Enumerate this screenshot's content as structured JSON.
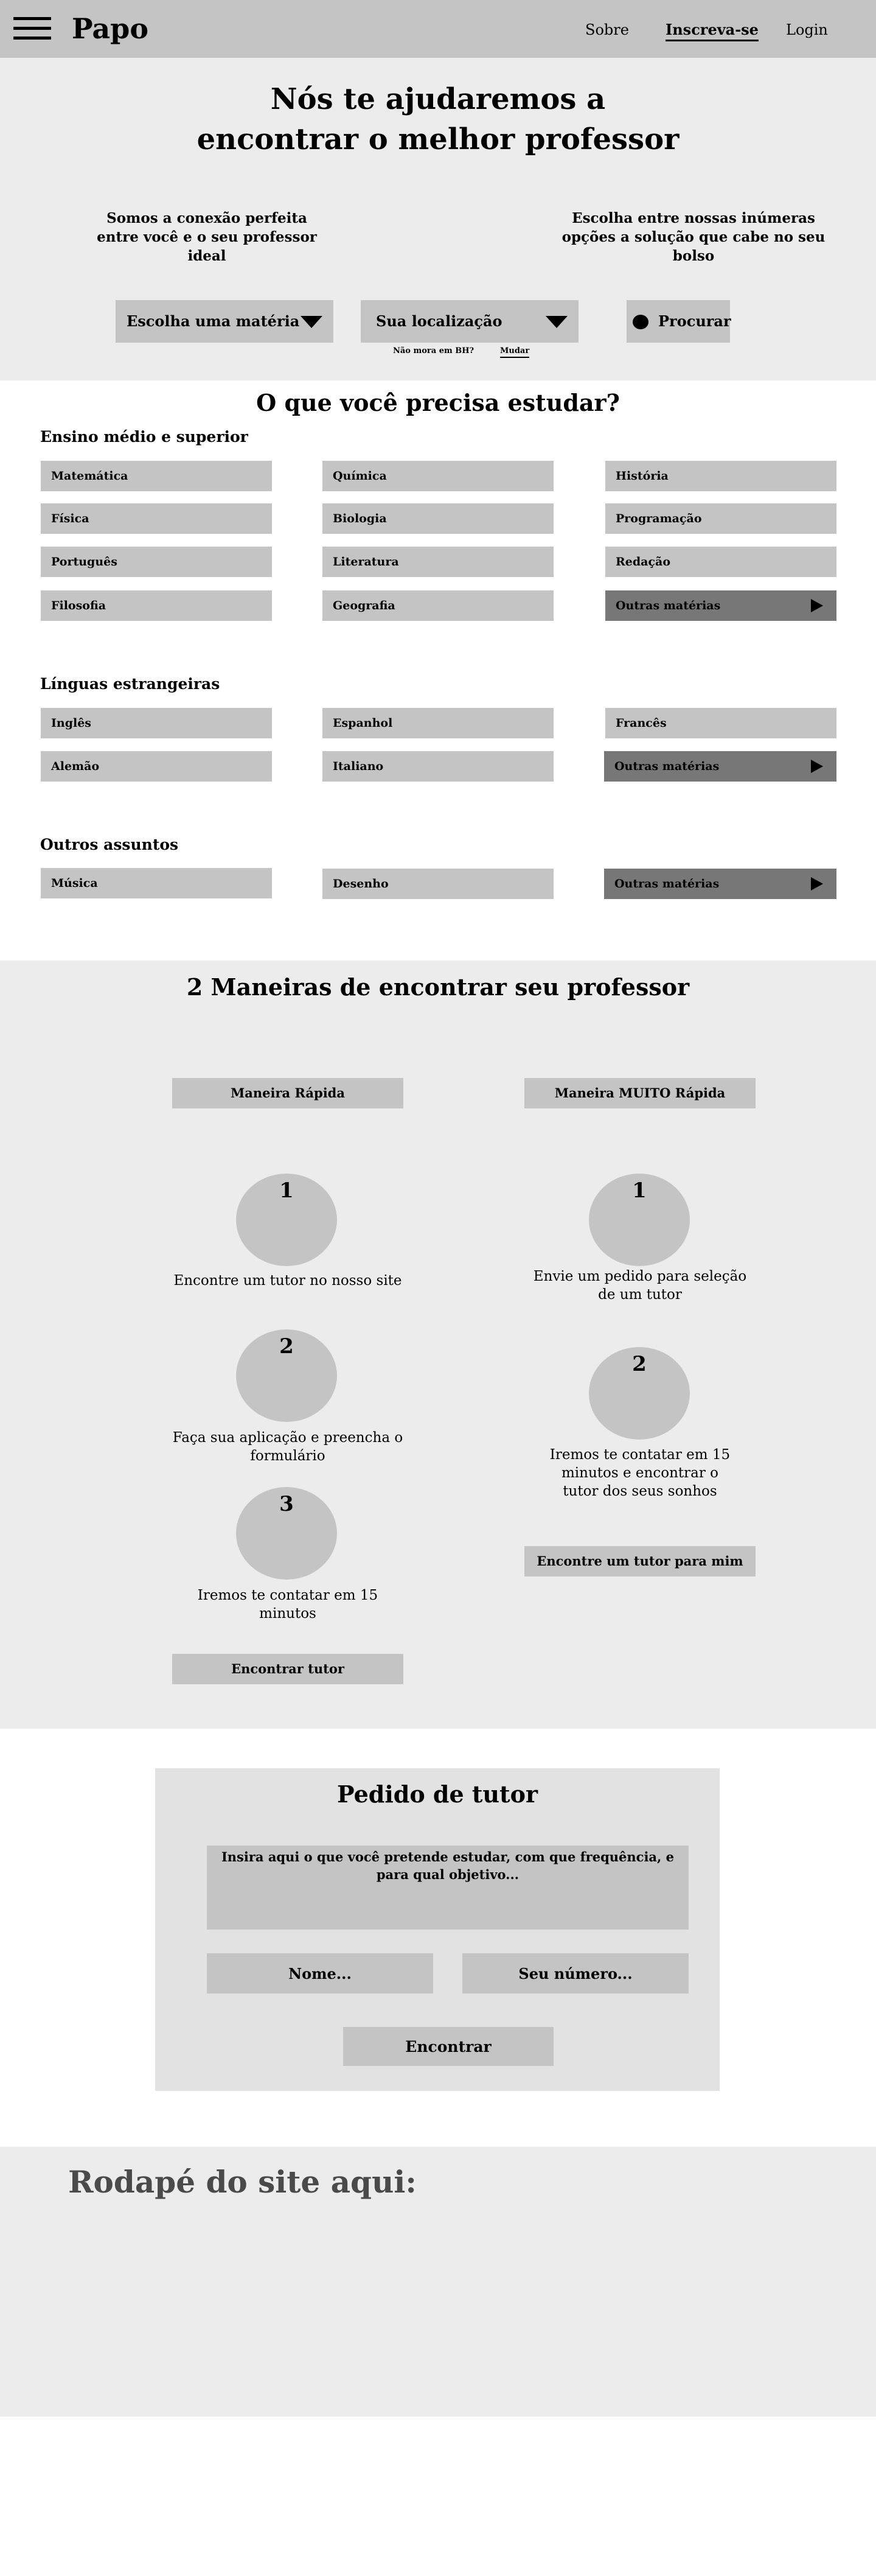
{
  "header": {
    "logo": "Papo",
    "nav": {
      "sobre": "Sobre",
      "inscreva": "Inscreva-se",
      "login": "Login"
    }
  },
  "hero": {
    "title": "Nós te ajudaremos a encontrar o melhor professor",
    "left_text": "Somos a conexão perfeita entre você e o seu professor ideal",
    "right_text": "Escolha entre nossas inúmeras opções a solução que cabe no seu bolso",
    "select_materia": "Escolha uma matéria",
    "select_local": "Sua localização",
    "search_label": "Procurar",
    "local_note": "Não mora em BH?",
    "local_change": "Mudar"
  },
  "subjects": {
    "title": "O que você precisa estudar?",
    "groups": [
      {
        "title": "Ensino médio e superior",
        "items": [
          "Matemática",
          "Química",
          "História",
          "Física",
          "Biologia",
          "Programação",
          "Português",
          "Literatura",
          "Redação",
          "Filosofia",
          "Geografia"
        ],
        "more": "Outras matérias"
      },
      {
        "title": "Línguas estrangeiras",
        "items": [
          "Inglês",
          "Espanhol",
          "Francês",
          "Alemão",
          "Italiano"
        ],
        "more": "Outras matérias"
      },
      {
        "title": "Outros assuntos",
        "items": [
          "Música",
          "Desenho"
        ],
        "more": "Outras matérias"
      }
    ]
  },
  "ways": {
    "title": "2 Maneiras de encontrar seu professor",
    "fast": {
      "heading": "Maneira Rápida",
      "steps": [
        {
          "n": "1",
          "text": "Encontre um tutor no nosso site"
        },
        {
          "n": "2",
          "text": "Faça sua aplicação e preencha o formulário"
        },
        {
          "n": "3",
          "text": "Iremos te contatar em 15 minutos"
        }
      ],
      "button": "Encontrar tutor"
    },
    "very_fast": {
      "heading": "Maneira MUITO Rápida",
      "steps": [
        {
          "n": "1",
          "text": "Envie um pedido para seleção de um tutor"
        },
        {
          "n": "2",
          "text": "Iremos te contatar em 15 minutos e encontrar o tutor dos seus sonhos"
        }
      ],
      "button": "Encontre um tutor para mim"
    }
  },
  "request_form": {
    "title": "Pedido de tutor",
    "textarea_placeholder": "Insira aqui o que você pretende estudar, com que frequência, e para qual objetivo...",
    "name_placeholder": "Nome...",
    "number_placeholder": "Seu número...",
    "submit": "Encontrar"
  },
  "footer": {
    "text": "Rodapé do site aqui:"
  },
  "colors": {
    "header_bg": "#c4c4c4",
    "section_bg": "#ececec",
    "chip_bg": "#c4c4c4",
    "chip_dark_bg": "#777777",
    "form_bg": "#e2e2e2"
  }
}
